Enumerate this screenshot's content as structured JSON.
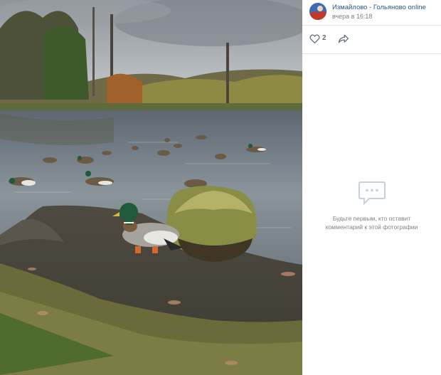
{
  "author": {
    "name": "Измайлово - Гольяново online",
    "time": "вчера в 16:18"
  },
  "actions": {
    "likes": "2",
    "like_icon": "heart-icon",
    "share_icon": "share-arrow-icon"
  },
  "comments": {
    "empty_line1": "Будьте первым, кто оставит",
    "empty_line2": "комментарий к этой фотографии",
    "icon": "comment-bubble-icon"
  },
  "colors": {
    "link": "#2a5885",
    "muted": "#828282",
    "divider": "#e7e8ec"
  }
}
